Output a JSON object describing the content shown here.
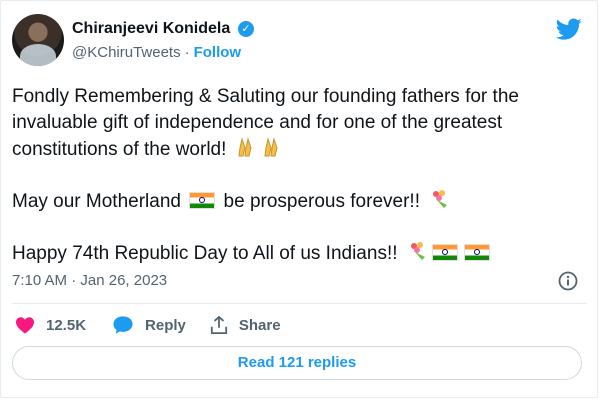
{
  "user": {
    "name": "Chiranjeevi Konidela",
    "handle": "@KChiruTweets",
    "separator": "·",
    "follow_label": "Follow"
  },
  "tweet": {
    "line1": "Fondly Remembering & Saluting our founding fathers for the invaluable gift of independence and for one of the greatest constitutions of the world!",
    "line2_before": "May our Motherland",
    "line2_after": "be prosperous forever!!",
    "line3": "Happy 74th Republic Day to All of us Indians!!"
  },
  "meta": {
    "time": "7:10 AM",
    "date_sep": " · ",
    "date": "Jan 26, 2023"
  },
  "actions": {
    "like_count": "12.5K",
    "reply_label": "Reply",
    "share_label": "Share"
  },
  "footer": {
    "read_replies_label": "Read 121 replies"
  },
  "colors": {
    "accent": "#1d9bf0",
    "like": "#f91880",
    "muted": "#536471"
  },
  "icons": {
    "verified": "verified-badge-icon",
    "brand": "twitter-bird-icon",
    "info": "info-icon",
    "like": "heart-icon",
    "reply": "speech-bubble-icon",
    "share": "share-icon",
    "emoji_pray": "folded-hands-icon",
    "emoji_bouquet": "bouquet-icon",
    "flag": "india-flag-icon"
  }
}
